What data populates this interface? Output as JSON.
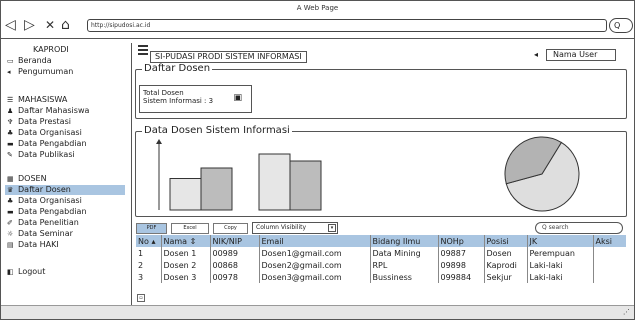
{
  "browser": {
    "title": "A Web Page",
    "url": "http://sipudosi.ac.id",
    "nav_back": "◁",
    "nav_forward": "▷",
    "nav_close": "✕",
    "nav_home": "⌂",
    "search_glyph": "Q"
  },
  "sidebar": {
    "items": [
      {
        "label": "KAPRODI",
        "icon": ""
      },
      {
        "label": "Beranda",
        "icon": "▭"
      },
      {
        "label": "Pengumuman",
        "icon": "◂"
      },
      {
        "label": "MAHASISWA",
        "icon": "☰"
      },
      {
        "label": "Daftar Mahasiswa",
        "icon": "♟"
      },
      {
        "label": "Data Prestasi",
        "icon": "♆"
      },
      {
        "label": "Data Organisasi",
        "icon": "♣"
      },
      {
        "label": "Data Pengabdian",
        "icon": "▬"
      },
      {
        "label": "Data Publikasi",
        "icon": "✎"
      },
      {
        "label": "DOSEN",
        "icon": "▦"
      },
      {
        "label": "Daftar Dosen",
        "icon": "♛"
      },
      {
        "label": "Data Organisasi",
        "icon": "♣"
      },
      {
        "label": "Data Pengabdian",
        "icon": "▬"
      },
      {
        "label": "Data Penelitian",
        "icon": "✐"
      },
      {
        "label": "Data Seminar",
        "icon": "☼"
      },
      {
        "label": "Data HAKI",
        "icon": "▤"
      },
      {
        "label": "Logout",
        "icon": "◧"
      }
    ]
  },
  "header": {
    "app_title": "SI-PUDASI PRODI SISTEM INFORMASI",
    "bell_glyph": "◂",
    "user_label": "Nama User"
  },
  "main": {
    "section_title": "Daftar Dosen",
    "total_label": "Total Dosen",
    "total_value": "Sistem Informasi : 3",
    "lock_glyph": "▣",
    "chart_section_title": "Data Dosen Sistem Informasi"
  },
  "toolbar": {
    "pdf": "PDF",
    "excel": "Excel",
    "copy": "Copy",
    "column_visibility": "Column Visibility",
    "dropdown_glyph": "▾",
    "search_placeholder": "Q search"
  },
  "table": {
    "headers": [
      "No",
      "Nama",
      "NIK/NIP",
      "Email",
      "Bidang Ilmu",
      "NOHp",
      "Posisi",
      "JK",
      "Aksi"
    ],
    "sort_glyph": "▴",
    "sort_glyph2": "⇕",
    "rows": [
      [
        "1",
        "Dosen 1",
        "00989",
        "Dosen1@gmail.com",
        "Data Mining",
        "09887",
        "Dosen",
        "Perempuan",
        ""
      ],
      [
        "2",
        "Dosen 2",
        "00868",
        "Dosen2@gmail.com",
        "RPL",
        "09898",
        "Kaprodi",
        "Laki-laki",
        ""
      ],
      [
        "3",
        "Dosen 3",
        "00978",
        "Dosen3@gmail.com",
        "Bussiness",
        "099884",
        "Sekjur",
        "Laki-laki",
        ""
      ]
    ]
  },
  "colors": {
    "accent": "#a9c5e1",
    "bar_dark": "#bcbcbc",
    "bar_light": "#e6e6e6",
    "pie_large": "#dedede",
    "pie_small": "#b3b3b3"
  },
  "chart_data": {
    "type": "bar",
    "categories": [
      "",
      ""
    ],
    "series": [
      {
        "values": [
          45,
          80
        ]
      },
      {
        "values": [
          60,
          70
        ]
      }
    ],
    "ylim": [
      0,
      100
    ],
    "pie": {
      "type": "pie",
      "slices": [
        {
          "value": 0.62
        },
        {
          "value": 0.38
        }
      ]
    }
  }
}
